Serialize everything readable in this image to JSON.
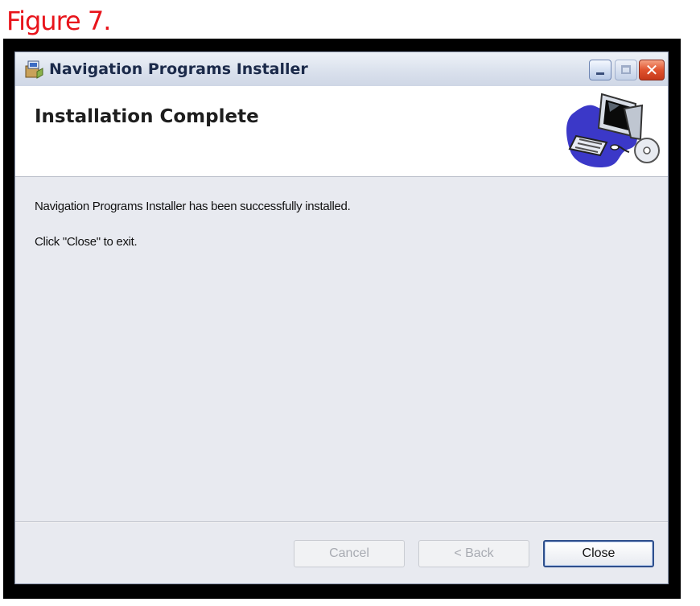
{
  "figure_label": "Figure 7.",
  "window": {
    "title": "Navigation Programs Installer",
    "icon": "installer-app-icon",
    "controls": {
      "minimize": "minimize-icon",
      "maximize": "maximize-icon",
      "close": "close-icon",
      "close_glyph": "✕"
    }
  },
  "banner": {
    "title": "Installation Complete",
    "art": "computer-with-disc-illustration"
  },
  "content": {
    "message": "Navigation Programs Installer has been successfully installed.",
    "instruction": "Click \"Close\" to exit."
  },
  "buttons": {
    "cancel": {
      "label": "Cancel",
      "enabled": false
    },
    "back": {
      "label": "< Back",
      "enabled": false
    },
    "close": {
      "label": "Close",
      "enabled": true
    }
  },
  "colors": {
    "figure_label": "#e8141b",
    "close_caption": "#e0532e",
    "window_body": "#e8eaf0"
  }
}
